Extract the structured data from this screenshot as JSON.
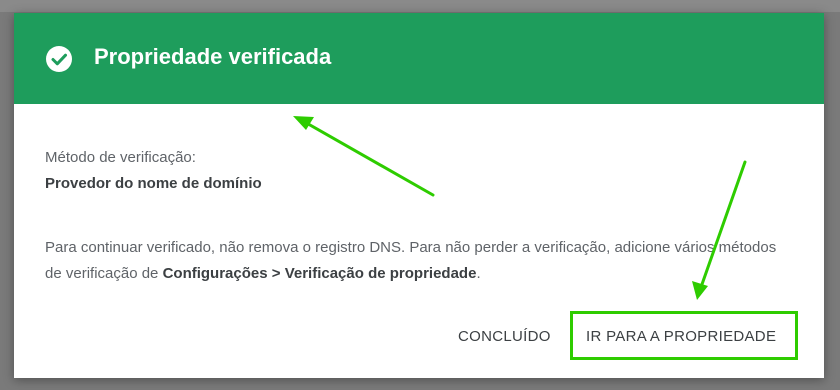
{
  "dialog": {
    "title": "Propriedade verificada",
    "method_label": "Método de verificação:",
    "method_value": "Provedor do nome de domínio",
    "info_part1": "Para continuar verificado, não remova o registro DNS. Para não perder a verificação, adicione vários métodos de verificação de ",
    "info_bold": "Configurações > Verificação de propriedade",
    "info_part2": ".",
    "buttons": {
      "done": "CONCLUÍDO",
      "go_to_property": "IR PARA A PROPRIEDADE"
    }
  },
  "colors": {
    "header_green": "#1e9d5c",
    "annotation_green": "#2ecc00"
  },
  "icons": {
    "header_icon": "check-circle-icon"
  }
}
